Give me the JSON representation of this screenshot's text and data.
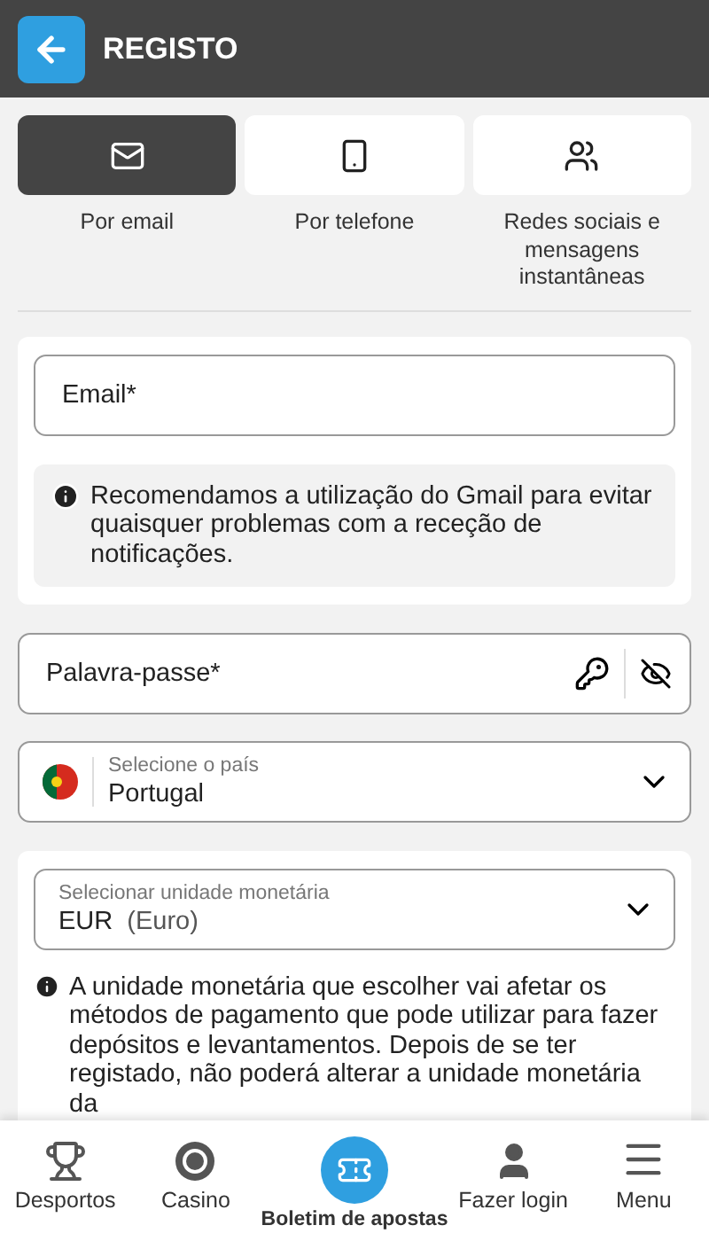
{
  "header": {
    "title": "REGISTO"
  },
  "tabs": [
    {
      "label": "Por email",
      "kind": "email",
      "selected": true
    },
    {
      "label": "Por telefone",
      "kind": "phone",
      "selected": false
    },
    {
      "label": "Redes sociais e mensagens instantâneas",
      "kind": "social",
      "selected": false
    }
  ],
  "email_card": {
    "placeholder": "Email*",
    "notice": "Recomendamos a utilização do Gmail para evitar quaisquer problemas com a receção de notificações."
  },
  "password": {
    "placeholder": "Palavra-passe*"
  },
  "country": {
    "label": "Selecione o país",
    "value": "Portugal"
  },
  "currency": {
    "label": "Selecionar unidade monetária",
    "code": "EUR",
    "name": "(Euro)",
    "notice": "A unidade monetária que escolher vai afetar os métodos de pagamento que pode utilizar para fazer depósitos e levantamentos. Depois de se ter registado, não poderá alterar a unidade monetária da"
  },
  "bottom_nav": [
    {
      "label": "Desportos",
      "kind": "trophy"
    },
    {
      "label": "Casino",
      "kind": "chip"
    },
    {
      "label": "Boletim de apostas",
      "kind": "ticket"
    },
    {
      "label": "Fazer login",
      "kind": "user"
    },
    {
      "label": "Menu",
      "kind": "menu"
    }
  ]
}
